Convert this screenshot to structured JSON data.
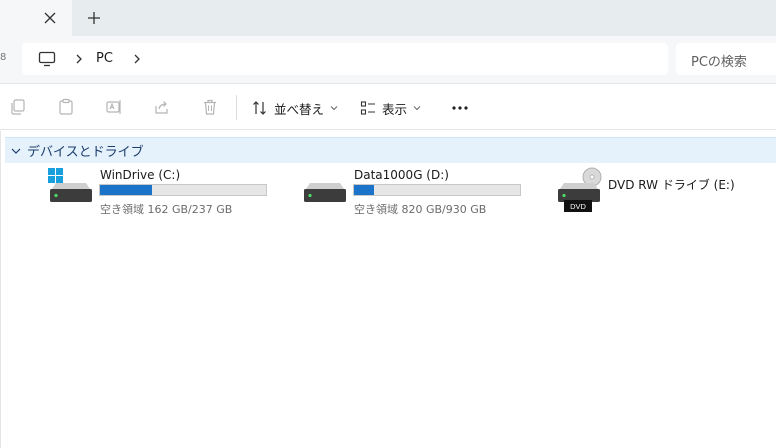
{
  "tabs": {
    "close_label": "✕",
    "new_label": "+"
  },
  "address": {
    "left_edge_glyph": "8",
    "crumbs": [
      "PC"
    ],
    "search_placeholder": "PCの検索"
  },
  "commandbar": {
    "sort_label": "並べ替え",
    "view_label": "表示",
    "more_label": "•••"
  },
  "group": {
    "label": "デバイスとドライブ"
  },
  "drives": [
    {
      "name": "WinDrive (C:)",
      "free_text": "空き領域 162 GB/237 GB",
      "used_fraction": 0.316
    },
    {
      "name": "Data1000G (D:)",
      "free_text": "空き領域 820 GB/930 GB",
      "used_fraction": 0.118
    },
    {
      "name": "DVD RW ドライブ (E:)",
      "badge": "DVD"
    }
  ],
  "colors": {
    "accent": "#1b74c9",
    "group_bg": "#e5f1fb",
    "tabbar": "#e7ecee"
  }
}
